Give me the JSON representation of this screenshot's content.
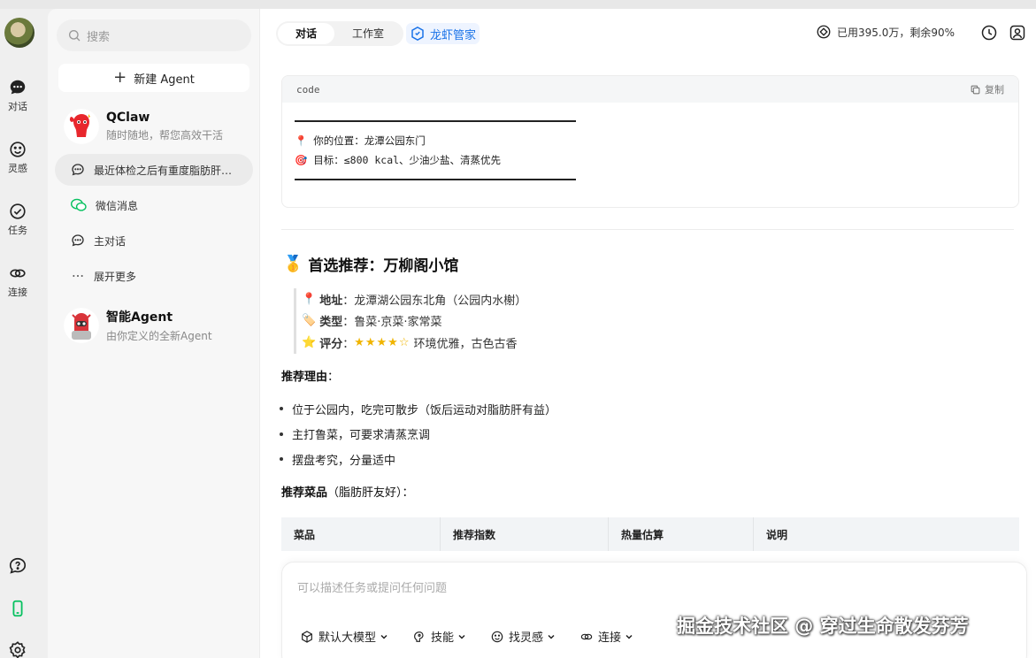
{
  "rail": {
    "items": [
      {
        "label": "对话"
      },
      {
        "label": "灵感"
      },
      {
        "label": "任务"
      },
      {
        "label": "连接"
      }
    ]
  },
  "sidebar": {
    "search_placeholder": "搜索",
    "new_agent_label": "新建 Agent",
    "agents": [
      {
        "name": "QClaw",
        "desc": "随时随地，帮您高效干活"
      },
      {
        "name": "智能Agent",
        "desc": "由你定义的全新Agent"
      }
    ],
    "items": [
      {
        "label": "最近体检之后有重度脂肪肝…"
      },
      {
        "label": "微信消息"
      },
      {
        "label": "主对话"
      },
      {
        "label": "展开更多"
      }
    ]
  },
  "header": {
    "tabs": [
      {
        "label": "对话"
      },
      {
        "label": "工作室"
      }
    ],
    "brand_tab": "龙虾管家",
    "usage": "已用395.0万，剩余90%"
  },
  "code_block": {
    "lang": "code",
    "copy_label": "复制",
    "line1": "📍 你的位置：龙潭公园东门",
    "line2": "🎯 目标：≤800 kcal、少油少盐、清蒸优先"
  },
  "recommend": {
    "title": "首选推荐：万柳阁小馆",
    "address_label": "地址",
    "address": "：龙潭湖公园东北角（公园内水榭）",
    "type_label": "类型",
    "type": "：鲁菜·京菜·家常菜",
    "rating_label": "评分",
    "rating_sep": "：",
    "rating_stars": "★★★★☆",
    "rating_value": 4,
    "rating_text": "环境优雅，古色古香",
    "reason_title": "推荐理由",
    "reason_colon": "：",
    "reasons": [
      "位于公园内，吃完可散步（饭后运动对脂肪肝有益）",
      "主打鲁菜，可要求清蒸烹调",
      "摆盘考究，分量适中"
    ],
    "dishes_title": "推荐菜品",
    "dishes_note": "（脂肪肝友好）：",
    "table_headers": [
      "菜品",
      "推荐指数",
      "热量估算",
      "说明"
    ]
  },
  "composer": {
    "placeholder": "可以描述任务或提问任何问题",
    "tools": [
      {
        "label": "默认大模型"
      },
      {
        "label": "技能"
      },
      {
        "label": "找灵感"
      },
      {
        "label": "连接"
      }
    ]
  },
  "watermark": "掘金技术社区 @ 穿过生命散发芬芳",
  "colors": {
    "accent": "#1a73e8",
    "wechat": "#07c160",
    "star": "#f0b400"
  }
}
